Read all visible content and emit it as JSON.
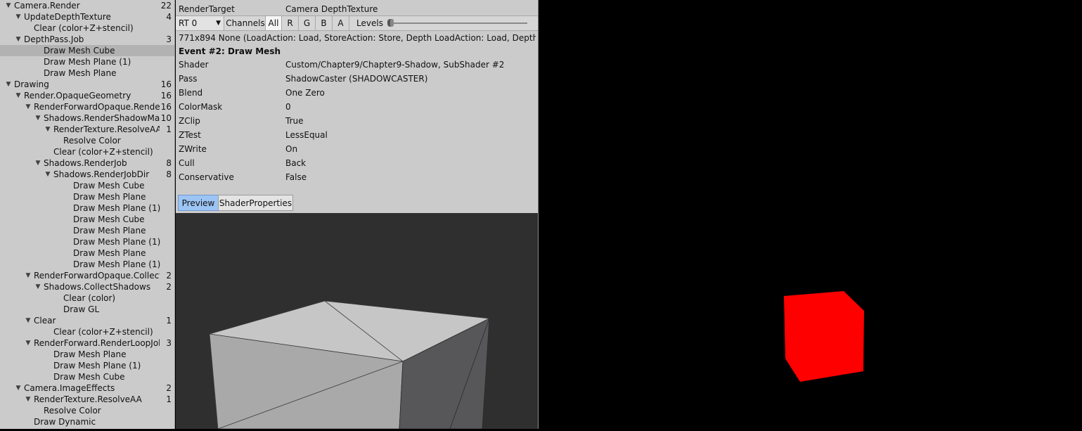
{
  "tree": [
    {
      "label": "Camera.Render",
      "count": "22",
      "depth": 0,
      "expanded": true
    },
    {
      "label": "UpdateDepthTexture",
      "count": "4",
      "depth": 1,
      "expanded": true
    },
    {
      "label": "Clear (color+Z+stencil)",
      "count": "",
      "depth": 2,
      "expanded": null
    },
    {
      "label": "DepthPass.Job",
      "count": "3",
      "depth": 1,
      "expanded": true
    },
    {
      "label": "Draw Mesh Cube",
      "count": "",
      "depth": 3,
      "expanded": null,
      "selected": true
    },
    {
      "label": "Draw Mesh Plane (1)",
      "count": "",
      "depth": 3,
      "expanded": null
    },
    {
      "label": "Draw Mesh Plane",
      "count": "",
      "depth": 3,
      "expanded": null
    },
    {
      "label": "Drawing",
      "count": "16",
      "depth": 0,
      "expanded": true
    },
    {
      "label": "Render.OpaqueGeometry",
      "count": "16",
      "depth": 1,
      "expanded": true
    },
    {
      "label": "RenderForwardOpaque.Render",
      "count": "16",
      "depth": 2,
      "expanded": true
    },
    {
      "label": "Shadows.RenderShadowMap",
      "count": "10",
      "depth": 3,
      "expanded": true
    },
    {
      "label": "RenderTexture.ResolveAA",
      "count": "1",
      "depth": 4,
      "expanded": true
    },
    {
      "label": "Resolve Color",
      "count": "",
      "depth": 5,
      "expanded": null
    },
    {
      "label": "Clear (color+Z+stencil)",
      "count": "",
      "depth": 4,
      "expanded": null
    },
    {
      "label": "Shadows.RenderJob",
      "count": "8",
      "depth": 3,
      "expanded": true
    },
    {
      "label": "Shadows.RenderJobDir",
      "count": "8",
      "depth": 4,
      "expanded": true
    },
    {
      "label": "Draw Mesh Cube",
      "count": "",
      "depth": 6,
      "expanded": null
    },
    {
      "label": "Draw Mesh Plane",
      "count": "",
      "depth": 6,
      "expanded": null
    },
    {
      "label": "Draw Mesh Plane (1)",
      "count": "",
      "depth": 6,
      "expanded": null
    },
    {
      "label": "Draw Mesh Cube",
      "count": "",
      "depth": 6,
      "expanded": null
    },
    {
      "label": "Draw Mesh Plane",
      "count": "",
      "depth": 6,
      "expanded": null
    },
    {
      "label": "Draw Mesh Plane (1)",
      "count": "",
      "depth": 6,
      "expanded": null
    },
    {
      "label": "Draw Mesh Plane",
      "count": "",
      "depth": 6,
      "expanded": null
    },
    {
      "label": "Draw Mesh Plane (1)",
      "count": "",
      "depth": 6,
      "expanded": null
    },
    {
      "label": "RenderForwardOpaque.CollectShadows",
      "count": "2",
      "depth": 2,
      "expanded": true
    },
    {
      "label": "Shadows.CollectShadows",
      "count": "2",
      "depth": 3,
      "expanded": true
    },
    {
      "label": "Clear (color)",
      "count": "",
      "depth": 5,
      "expanded": null
    },
    {
      "label": "Draw GL",
      "count": "",
      "depth": 5,
      "expanded": null
    },
    {
      "label": "Clear",
      "count": "1",
      "depth": 2,
      "expanded": true
    },
    {
      "label": "Clear (color+Z+stencil)",
      "count": "",
      "depth": 4,
      "expanded": null
    },
    {
      "label": "RenderForward.RenderLoopJob",
      "count": "3",
      "depth": 2,
      "expanded": true
    },
    {
      "label": "Draw Mesh Plane",
      "count": "",
      "depth": 4,
      "expanded": null
    },
    {
      "label": "Draw Mesh Plane (1)",
      "count": "",
      "depth": 4,
      "expanded": null
    },
    {
      "label": "Draw Mesh Cube",
      "count": "",
      "depth": 4,
      "expanded": null
    },
    {
      "label": "Camera.ImageEffects",
      "count": "2",
      "depth": 1,
      "expanded": true
    },
    {
      "label": "RenderTexture.ResolveAA",
      "count": "1",
      "depth": 2,
      "expanded": true
    },
    {
      "label": "Resolve Color",
      "count": "",
      "depth": 3,
      "expanded": null
    },
    {
      "label": "Draw Dynamic",
      "count": "",
      "depth": 2,
      "expanded": null
    }
  ],
  "detail": {
    "render_target_label": "RenderTarget",
    "render_target_value": "Camera DepthTexture",
    "toolbar": {
      "rt_select": "RT 0",
      "channels_label": "Channels",
      "channels": [
        "All",
        "R",
        "G",
        "B",
        "A"
      ],
      "levels_label": "Levels"
    },
    "info_line": "771x894 None (LoadAction: Load, StoreAction: Store, Depth LoadAction: Load, Depth Store",
    "event_title": "Event #2: Draw Mesh",
    "properties": [
      {
        "key": "Shader",
        "value": "Custom/Chapter9/Chapter9-Shadow, SubShader #2"
      },
      {
        "key": "Pass",
        "value": "ShadowCaster (SHADOWCASTER)"
      },
      {
        "key": "Blend",
        "value": "One Zero"
      },
      {
        "key": "ColorMask",
        "value": "0"
      },
      {
        "key": "ZClip",
        "value": "True"
      },
      {
        "key": "ZTest",
        "value": "LessEqual"
      },
      {
        "key": "ZWrite",
        "value": "On"
      },
      {
        "key": "Cull",
        "value": "Back"
      },
      {
        "key": "Conservative",
        "value": "False"
      }
    ],
    "tabs": {
      "preview": "Preview",
      "shader_properties": "ShaderProperties"
    }
  },
  "colors": {
    "panel": "#cbcbcb",
    "selected_row": "#b2b2b2",
    "active_tab": "#9cc5f5",
    "game_background": "#000000",
    "cube": "#ff0000",
    "preview_bg": "#2f2f2f"
  }
}
